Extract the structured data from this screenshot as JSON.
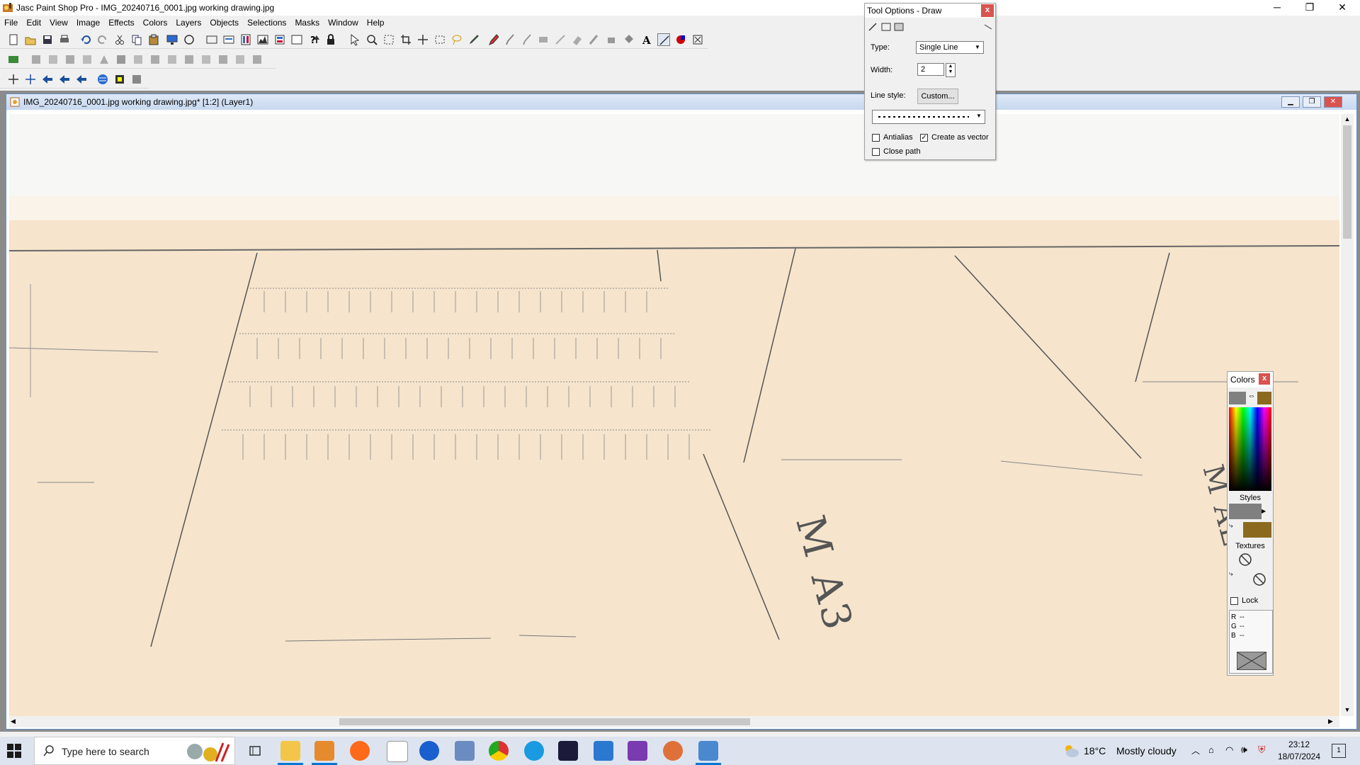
{
  "window": {
    "title": "Jasc Paint Shop Pro - IMG_20240716_0001.jpg  working drawing.jpg",
    "minimize": "─",
    "maximize": "❐",
    "close": "✕"
  },
  "menu": [
    "File",
    "Edit",
    "View",
    "Image",
    "Effects",
    "Colors",
    "Layers",
    "Objects",
    "Selections",
    "Masks",
    "Window",
    "Help"
  ],
  "document": {
    "title": "IMG_20240716_0001.jpg  working drawing.jpg* [1:2] (Layer1)",
    "canvas_labels": [
      "M A3",
      "M AL"
    ]
  },
  "tool_options": {
    "title": "Tool Options - Draw",
    "close": "x",
    "type_label": "Type:",
    "type_value": "Single Line",
    "width_label": "Width:",
    "width_value": "2",
    "line_style_label": "Line style:",
    "custom_button": "Custom...",
    "antialias_label": "Antialias",
    "antialias_checked": false,
    "create_vector_label": "Create as vector",
    "create_vector_checked": true,
    "close_path_label": "Close path",
    "close_path_checked": false
  },
  "colors_palette": {
    "title": "Colors",
    "close": "x",
    "styles_label": "Styles",
    "textures_label": "Textures",
    "lock_label": "Lock",
    "r_label": "R",
    "g_label": "G",
    "b_label": "B",
    "r_value": "--",
    "g_value": "--",
    "b_value": "--",
    "foreground_color": "#808080",
    "background_color": "#8b6a1f"
  },
  "taskbar": {
    "search_placeholder": "Type here to search",
    "weather_temp": "18°C",
    "weather_desc": "Mostly cloudy",
    "time": "23:12",
    "date": "18/07/2024",
    "notification_count": "1"
  },
  "colors": {
    "canvas_bg": "#f6e4cc",
    "accent": "#0078d7"
  }
}
